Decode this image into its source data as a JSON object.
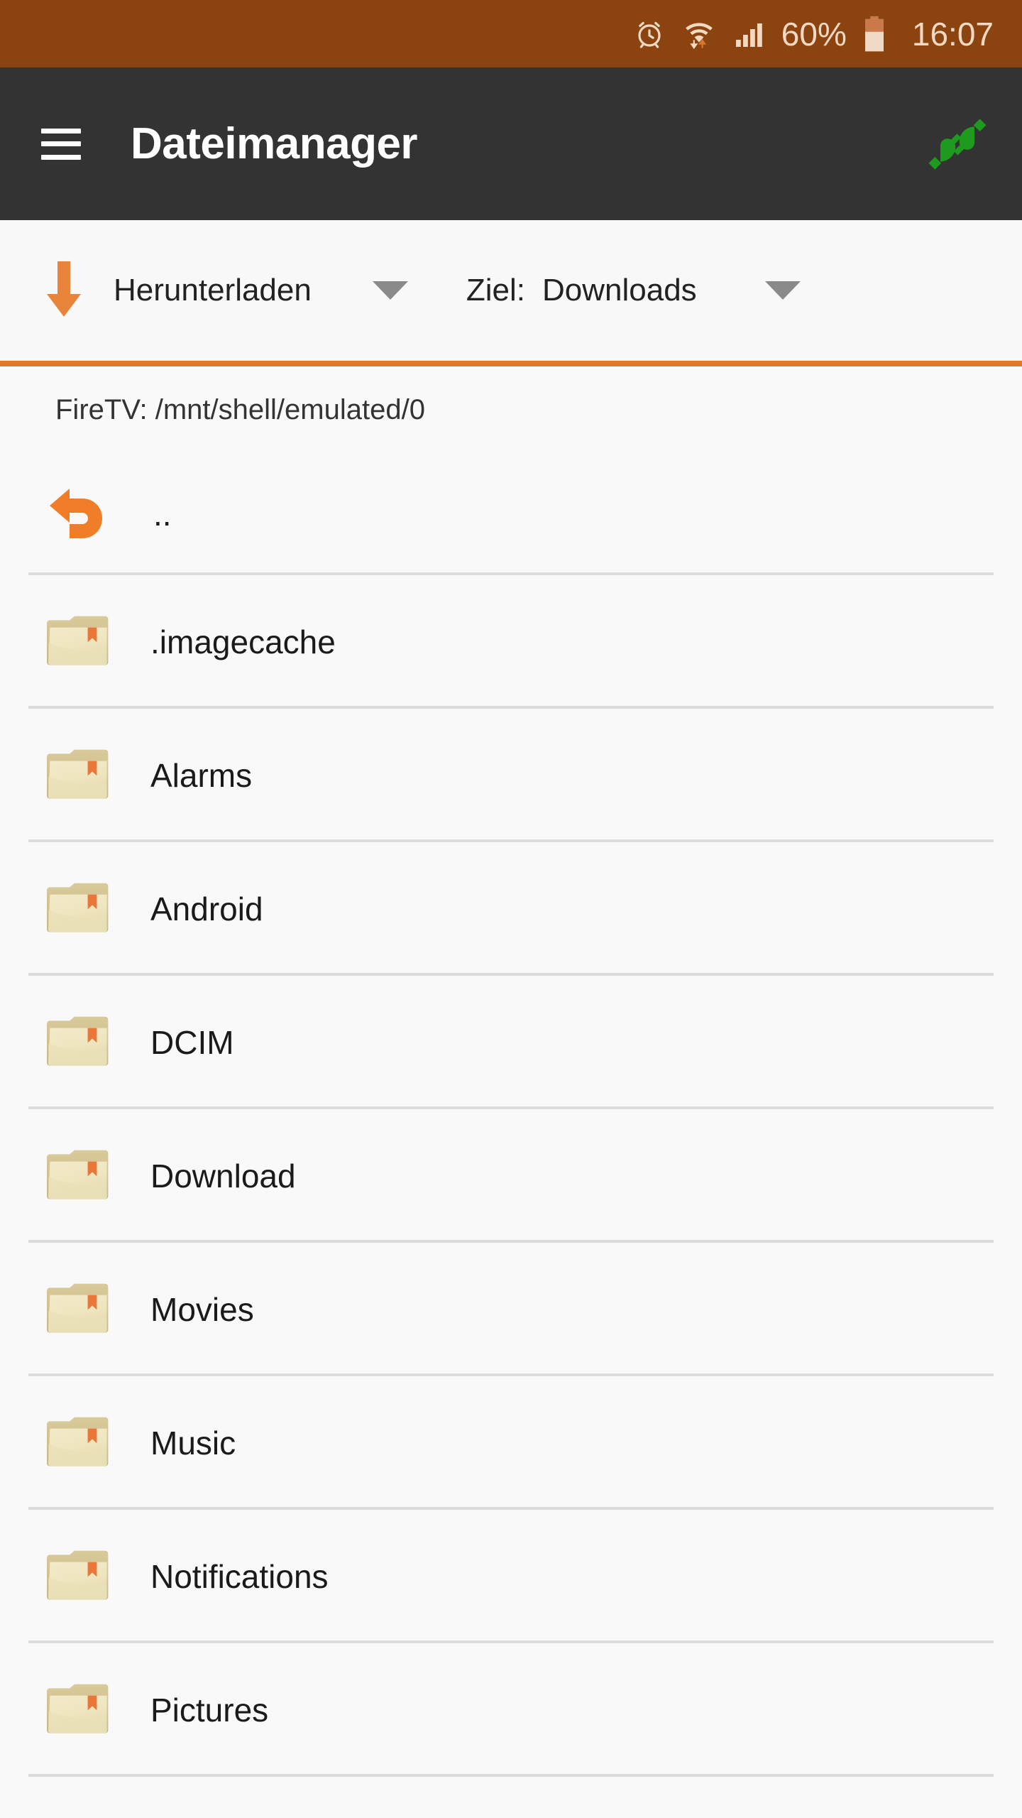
{
  "status_bar": {
    "background_color": "#8B4310",
    "foreground_color": "#F2D9C4",
    "battery_percent": "60%",
    "clock": "16:07",
    "icons": [
      "alarm-clock-icon",
      "wifi-icon",
      "signal-bars-icon",
      "battery-icon"
    ]
  },
  "app_bar": {
    "background_color": "#333333",
    "menu_icon": "hamburger-menu-icon",
    "title": "Dateimanager",
    "action_icon": "plug-connected-icon",
    "action_icon_color": "#1E9B1E"
  },
  "toolbar": {
    "background_color": "#F8F8F8",
    "mode": {
      "icon": "download-arrow-icon",
      "icon_color": "#E8853A",
      "label": "Herunterladen",
      "caret": "chevron-down-icon"
    },
    "target": {
      "key_label": "Ziel:",
      "value": "Downloads",
      "caret": "chevron-down-icon"
    }
  },
  "divider": {
    "color": "#E0792C"
  },
  "path_bar": {
    "text": "FireTV: /mnt/shell/emulated/0"
  },
  "file_list": {
    "parent_entry": {
      "label": "..",
      "icon": "back-arrow-icon",
      "icon_color": "#F07E28"
    },
    "items": [
      {
        "name": ".imagecache",
        "icon": "folder-icon"
      },
      {
        "name": "Alarms",
        "icon": "folder-icon"
      },
      {
        "name": "Android",
        "icon": "folder-icon"
      },
      {
        "name": "DCIM",
        "icon": "folder-icon"
      },
      {
        "name": "Download",
        "icon": "folder-icon"
      },
      {
        "name": "Movies",
        "icon": "folder-icon"
      },
      {
        "name": "Music",
        "icon": "folder-icon"
      },
      {
        "name": "Notifications",
        "icon": "folder-icon"
      },
      {
        "name": "Pictures",
        "icon": "folder-icon"
      }
    ]
  }
}
